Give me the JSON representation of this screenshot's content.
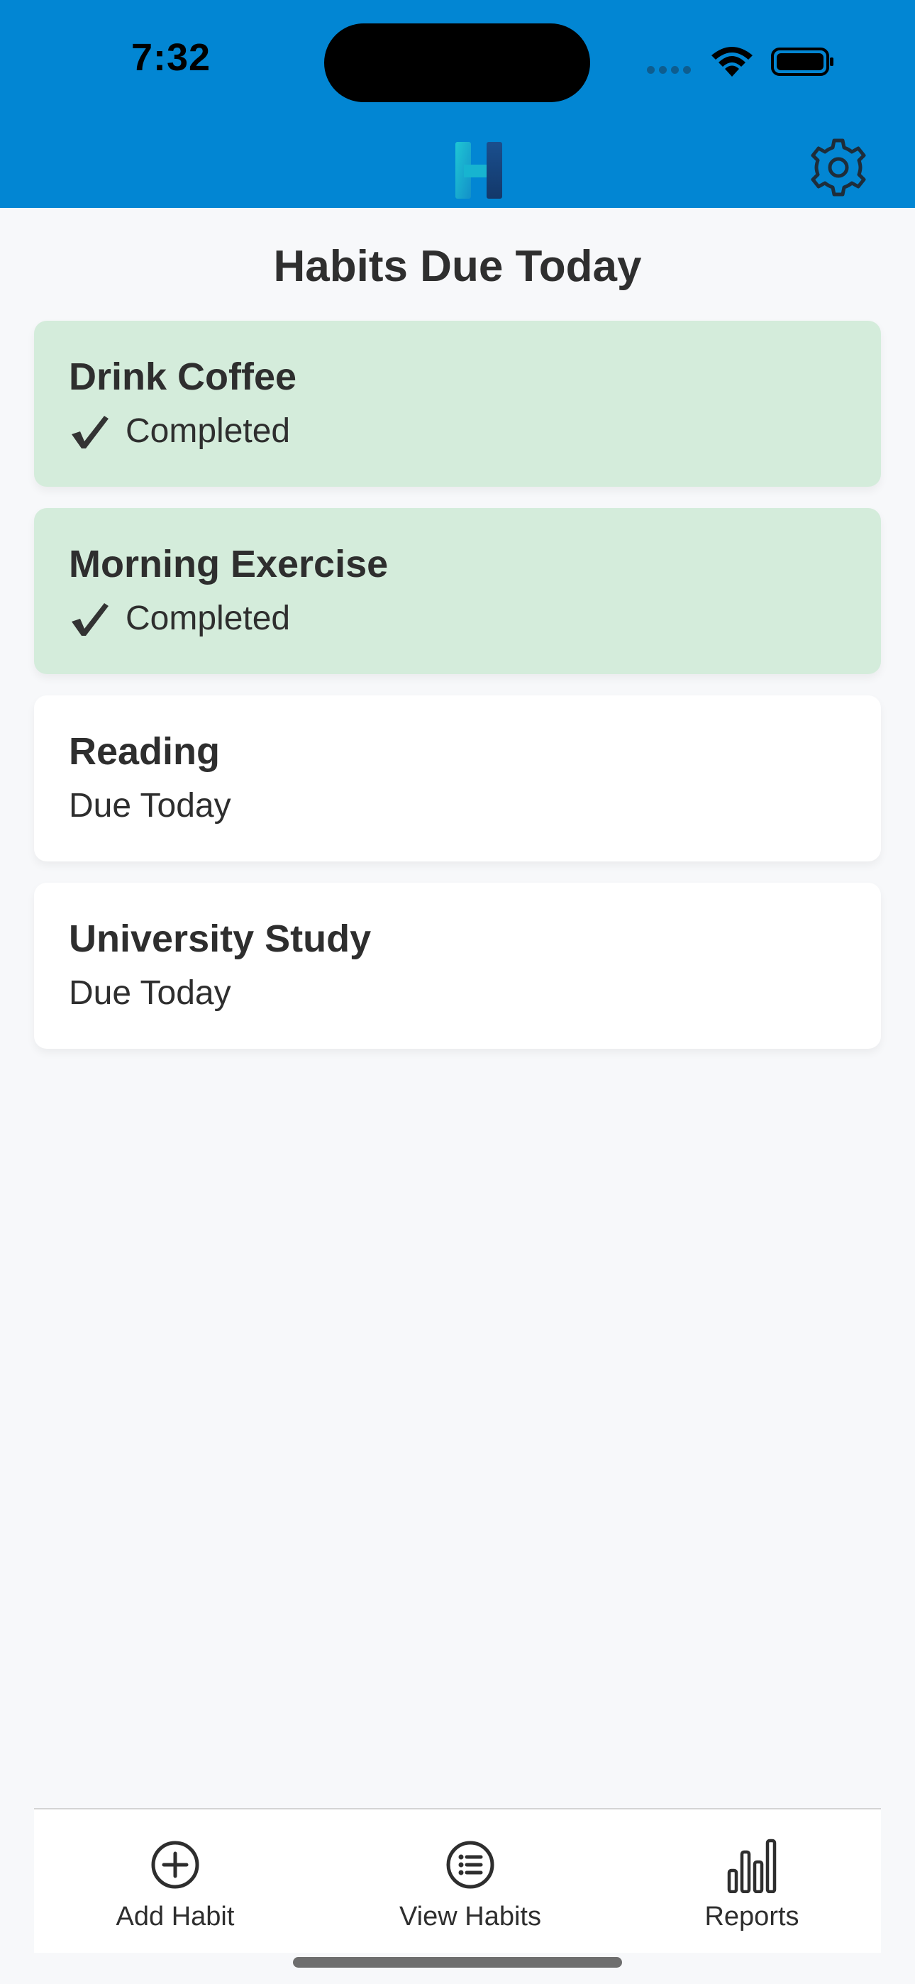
{
  "status_bar": {
    "time": "7:32"
  },
  "header": {
    "logo_icon": "app-logo-h",
    "settings_icon": "gear-icon",
    "colors": {
      "background": "#0286d3"
    }
  },
  "page": {
    "title": "Habits Due Today"
  },
  "habits": [
    {
      "name": "Drink Coffee",
      "status": "Completed",
      "completed": true
    },
    {
      "name": "Morning Exercise",
      "status": "Completed",
      "completed": true
    },
    {
      "name": "Reading",
      "status": "Due Today",
      "completed": false
    },
    {
      "name": "University Study",
      "status": "Due Today",
      "completed": false
    }
  ],
  "colors": {
    "completed_card": "#d4ecdb",
    "pending_card": "#ffffff",
    "page_background": "#f7f8fa"
  },
  "tab_bar": {
    "items": [
      {
        "label": "Add Habit",
        "icon": "plus-circle-icon"
      },
      {
        "label": "View Habits",
        "icon": "list-circle-icon"
      },
      {
        "label": "Reports",
        "icon": "bar-chart-icon"
      }
    ]
  }
}
